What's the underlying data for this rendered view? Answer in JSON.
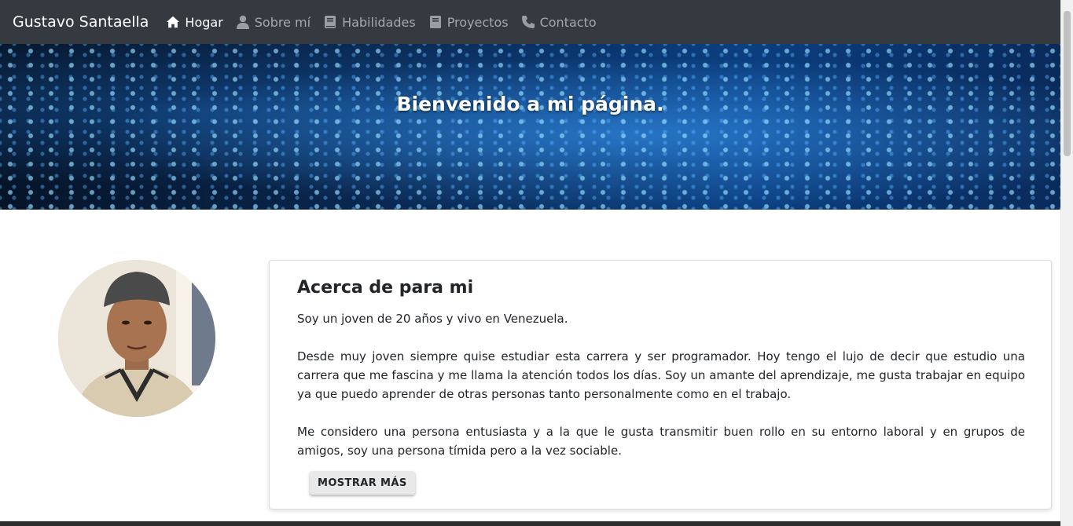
{
  "navbar": {
    "brand": "Gustavo Santaella",
    "items": [
      {
        "label": "Hogar",
        "icon": "home-icon",
        "active": true
      },
      {
        "label": "Sobre mí",
        "icon": "user-icon",
        "active": false
      },
      {
        "label": "Habilidades",
        "icon": "book-icon",
        "active": false
      },
      {
        "label": "Proyectos",
        "icon": "notebook-icon",
        "active": false
      },
      {
        "label": "Contacto",
        "icon": "phone-icon",
        "active": false
      }
    ]
  },
  "hero": {
    "title": "Bienvenido a mi página."
  },
  "about": {
    "title": "Acerca de para mi",
    "paragraphs": [
      "Soy un joven de 20 años y vivo en Venezuela.",
      "Desde muy joven siempre quise estudiar esta carrera y ser programador. Hoy tengo el lujo de decir que estudio una carrera que me fascina y me llama la atención todos los días. Soy un amante del aprendizaje, me gusta trabajar en equipo ya que puedo aprender de otras personas tanto personalmente como en el trabajo.",
      "Me considero una persona entusiasta y a la que le gusta transmitir buen rollo en su entorno laboral y en grupos de amigos, soy una persona tímida pero a la vez sociable."
    ],
    "button_label": "MOSTRAR MÁS"
  },
  "colors": {
    "navbar_bg": "#343a40",
    "nav_active": "#ffffff",
    "nav_inactive": "rgba(255,255,255,.55)"
  }
}
